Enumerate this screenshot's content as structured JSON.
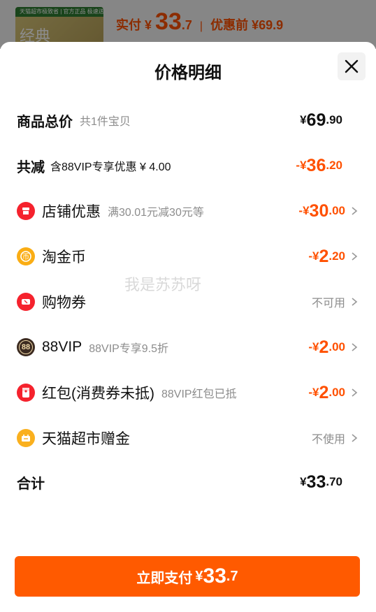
{
  "background": {
    "thumb_bar_text": "天猫超市极致省 | 官方正品 极速送达",
    "thumb_big_text": "经典",
    "price_label": "实付",
    "price_symbol": "¥",
    "price_int": "33",
    "price_dec": ".7",
    "before_label": "优惠前 ¥69.9"
  },
  "sheet": {
    "title": "价格明细",
    "close_icon": "close-icon"
  },
  "rows": {
    "total": {
      "label": "商品总价",
      "sub": "共1件宝贝",
      "sym": "¥",
      "int": "69",
      "dec": ".90"
    },
    "reduce": {
      "label": "共减",
      "sub": "含88VIP专享优惠 ¥ 4.00",
      "sym": "-¥",
      "int": "36",
      "dec": ".20"
    },
    "shop": {
      "label": "店铺优惠",
      "sub": "满30.01元减30元等",
      "sym": "-¥",
      "int": "30",
      "dec": ".00",
      "icon": "shop-icon",
      "color": "#f5222d"
    },
    "coin": {
      "label": "淘金币",
      "sym": "-¥",
      "int": "2",
      "dec": ".20",
      "icon": "coin-icon",
      "color": "#faad14"
    },
    "coupon": {
      "label": "购物券",
      "right_text": "不可用",
      "icon": "ticket-icon",
      "color": "#f5222d"
    },
    "vip": {
      "label": "88VIP",
      "sub": "88VIP专享9.5折",
      "sym": "-¥",
      "int": "2",
      "dec": ".00",
      "icon_text": "88",
      "color": "#3b2a20"
    },
    "redpacket": {
      "label": "红包(消费券未抵)",
      "sub": "88VIP红包已抵",
      "sym": "-¥",
      "int": "2",
      "dec": ".00",
      "icon": "red-packet-icon",
      "color": "#f5222d"
    },
    "tmall_gold": {
      "label": "天猫超市赠金",
      "right_text": "不使用",
      "icon": "gift-icon",
      "color": "#fab01e"
    },
    "sum": {
      "label": "合计",
      "sym": "¥",
      "int": "33",
      "dec": ".70"
    }
  },
  "watermark": "我是苏苏呀",
  "pay_button": {
    "label": "立即支付",
    "sym": "¥",
    "int": "33",
    "dec": ".7"
  },
  "colors": {
    "accent": "#ff5000",
    "button": "#ff5a00"
  }
}
